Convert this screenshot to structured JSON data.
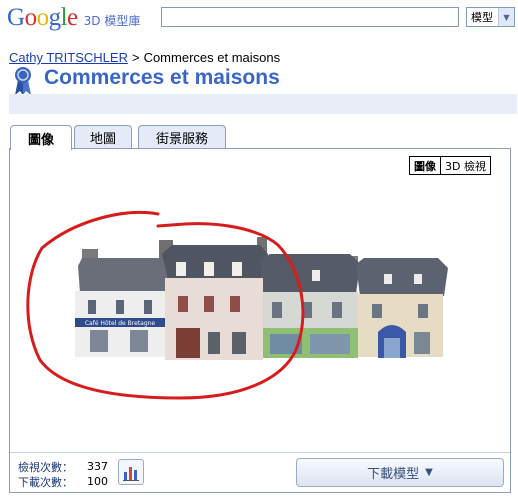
{
  "header": {
    "logo_letters": [
      "G",
      "o",
      "o",
      "g",
      "l",
      "e"
    ],
    "logo_colors": [
      "#3366cc",
      "#d92f2f",
      "#e8b50b",
      "#3366cc",
      "#2b9b3a",
      "#d92f2f"
    ],
    "product": "3D 模型庫",
    "search_value": "",
    "search_type": "模型"
  },
  "breadcrumb": {
    "author": "Cathy TRITSCHLER",
    "separator": ">",
    "current": "Commerces et maisons"
  },
  "page_title": "Commerces et maisons",
  "tabs": [
    {
      "label": "圖像",
      "active": true
    },
    {
      "label": "地圖",
      "active": false
    },
    {
      "label": "街景服務",
      "active": false
    }
  ],
  "view_toggle": {
    "image_label": "圖像",
    "three_d_label": "3D 檢視"
  },
  "model_image": {
    "sign_text": "Café Hôtel de Bretagne",
    "facade_colors": [
      "#eeeeee",
      "#e8dcd7",
      "#d6d9d3",
      "#e6dcc4"
    ],
    "annotation_color": "#d61c1c"
  },
  "stats": {
    "views_label": "檢視次數：",
    "views": "337",
    "downloads_label": "下載次數：",
    "downloads": "100"
  },
  "download_button": {
    "label": "下載模型",
    "arrow": "▼"
  }
}
